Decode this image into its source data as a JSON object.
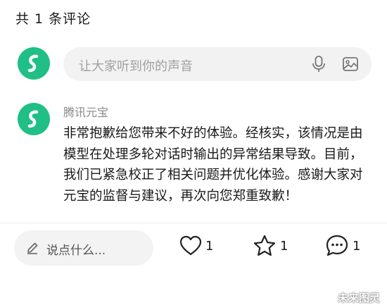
{
  "header": {
    "title": "共 1 条评论"
  },
  "input": {
    "placeholder": "让大家听到你的声音"
  },
  "comment": {
    "author": "腾讯元宝",
    "body": "非常抱歉给您带来不好的体验。经核实，该情况是由模型在处理多轮对话时输出的异常结果导致。目前，我们已紧急校正了相关问题并优化体验。感谢大家对元宝的监督与建议，再次向您郑重致歉！",
    "meta": "",
    "more": ""
  },
  "bottom_bar": {
    "say_label": "说点什么...",
    "like_count": "1",
    "favorite_count": "1",
    "comment_count": "1"
  },
  "watermark": "未来图灵",
  "colors": {
    "brand_green": "#1fbf86",
    "placeholder_gray": "#a0a0a0",
    "pill_bg": "#f2f2f2"
  },
  "icons": [
    "yuanbao-logo-icon",
    "mic-icon",
    "image-icon",
    "pencil-icon",
    "heart-icon",
    "star-icon",
    "chat-bubble-icon"
  ]
}
